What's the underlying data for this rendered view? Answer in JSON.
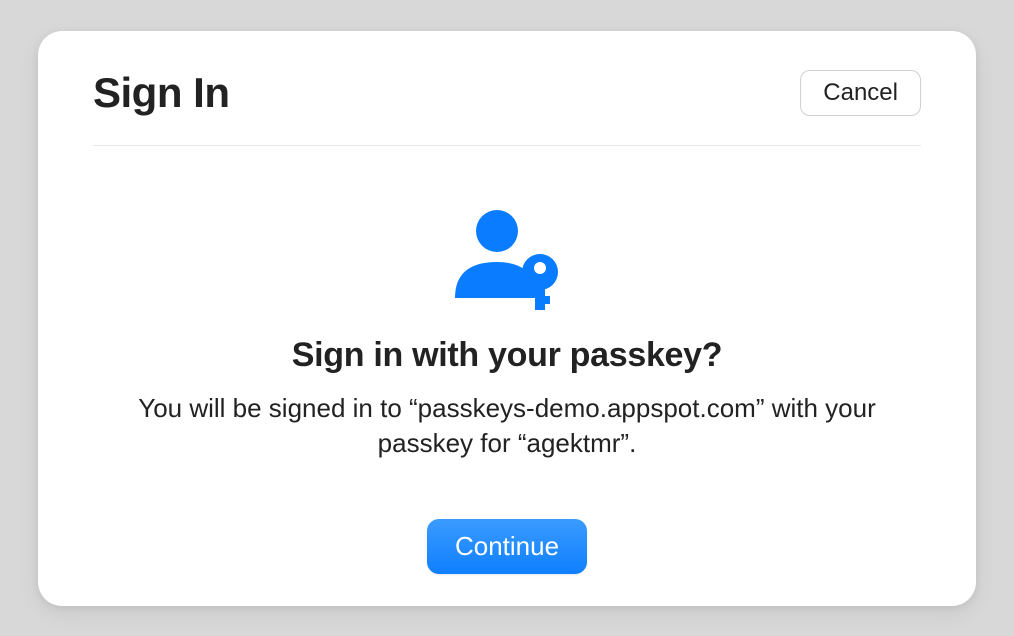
{
  "header": {
    "title": "Sign In",
    "cancel_label": "Cancel"
  },
  "content": {
    "icon_name": "passkey-icon",
    "subtitle": "Sign in with your passkey?",
    "description": "You will be signed in to “passkeys-demo.appspot.com” with your passkey for “agektmr”.",
    "continue_label": "Continue"
  },
  "colors": {
    "accent": "#0f7fff"
  }
}
